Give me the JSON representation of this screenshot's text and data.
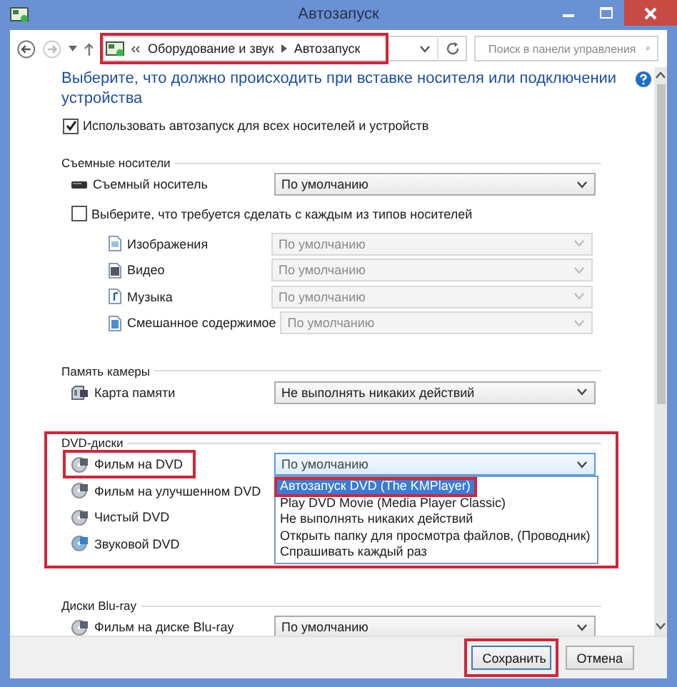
{
  "window": {
    "title": "Автозапуск"
  },
  "address": {
    "path": [
      "Оборудование и звук",
      "Автозапуск"
    ],
    "highlighted": true
  },
  "search": {
    "placeholder": "Поиск в панели управления"
  },
  "heading": "Выберите, что должно происходить при вставке носителя или подключении устройства",
  "use_autoplay": {
    "label": "Использовать автозапуск для всех носителей и устройств",
    "checked": true
  },
  "sections": [
    {
      "title": "Съемные носители",
      "highlighted": false,
      "items": [
        {
          "kind": "drive",
          "label": "Съемный носитель",
          "value": "По умолчанию",
          "disabled": false,
          "highlighted": false
        },
        {
          "kind": "checkbox",
          "label": "Выберите, что требуется сделать с каждым из типов носителей",
          "checked": false,
          "children": [
            {
              "kind": "image-file",
              "label": "Изображения",
              "value": "По умолчанию",
              "disabled": true
            },
            {
              "kind": "video-file",
              "label": "Видео",
              "value": "По умолчанию",
              "disabled": true
            },
            {
              "kind": "music-file",
              "label": "Музыка",
              "value": "По умолчанию",
              "disabled": true
            },
            {
              "kind": "mixed-file",
              "label": "Смешанное содержимое",
              "value": "По умолчанию",
              "disabled": true
            }
          ]
        }
      ]
    },
    {
      "title": "Память камеры",
      "highlighted": false,
      "items": [
        {
          "kind": "memory-card",
          "label": "Карта памяти",
          "value": "Не выполнять никаких действий",
          "disabled": false,
          "highlighted": false
        }
      ]
    },
    {
      "title": "DVD-диски",
      "highlighted": true,
      "items": [
        {
          "kind": "disc",
          "label": "Фильм на DVD",
          "value": "По умолчанию",
          "disabled": false,
          "highlighted": true,
          "open": true,
          "options": [
            {
              "label": "Автозапуск DVD (The KMPlayer)",
              "selected": true,
              "highlighted": true
            },
            {
              "label": "Play DVD Movie (Media Player Classic)",
              "selected": false,
              "highlighted": false
            },
            {
              "label": "Не выполнять никаких действий",
              "selected": false,
              "highlighted": false
            },
            {
              "label": "Открыть папку для просмотра файлов, (Проводник)",
              "selected": false,
              "highlighted": false
            },
            {
              "label": "Спрашивать каждый раз",
              "selected": false,
              "highlighted": false
            }
          ]
        },
        {
          "kind": "disc",
          "label": "Фильм на улучшенном DVD",
          "highlighted": false
        },
        {
          "kind": "disc",
          "label": "Чистый DVD",
          "highlighted": false
        },
        {
          "kind": "audio-disc",
          "label": "Звуковой DVD",
          "highlighted": false
        }
      ]
    },
    {
      "title": "Диски Blu-ray",
      "highlighted": false,
      "items": [
        {
          "kind": "disc",
          "label": "Фильм на диске Blu-ray",
          "value": "По умолчанию",
          "disabled": false,
          "highlighted": false
        }
      ]
    }
  ],
  "buttons": [
    {
      "label": "Сохранить",
      "highlighted": true
    },
    {
      "label": "Отмена",
      "highlighted": false
    }
  ]
}
